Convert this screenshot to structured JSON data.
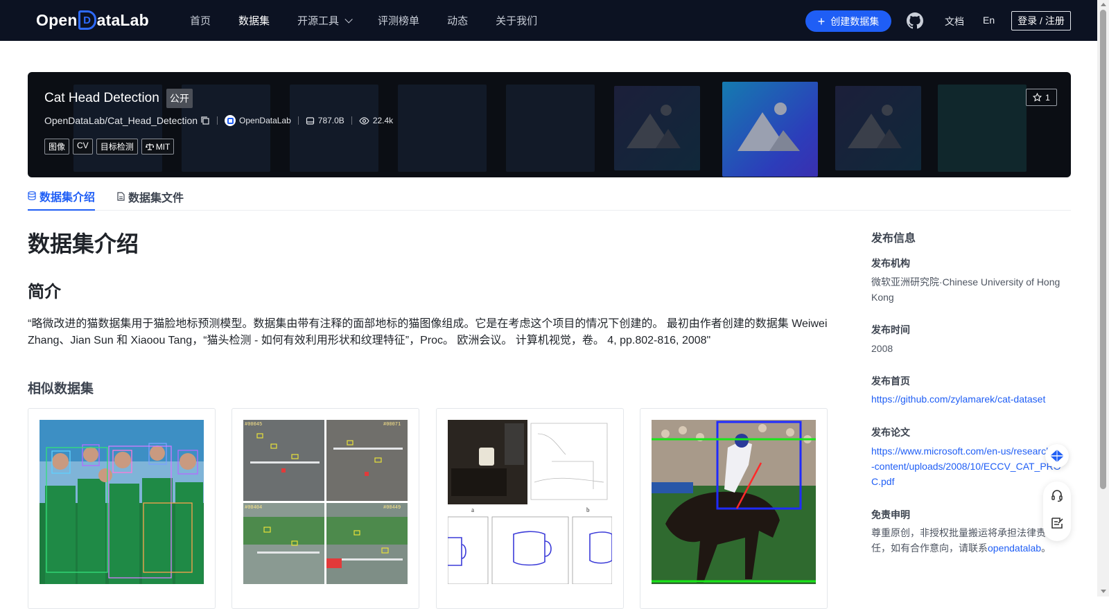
{
  "nav": {
    "logo": {
      "pre": "Open",
      "mark": "D",
      "post": "ataLab"
    },
    "items": [
      "首页",
      "数据集",
      "开源工具",
      "评测榜单",
      "动态",
      "关于我们"
    ],
    "active": "数据集",
    "create_label": "创建数据集",
    "docs_label": "文档",
    "lang_label": "En",
    "login_label": "登录 / 注册"
  },
  "dataset": {
    "title": "Cat Head Detection",
    "visibility": "公开",
    "path": "OpenDataLab/Cat_Head_Detection",
    "publisher": "OpenDataLab",
    "size": "787.0B",
    "views": "22.4k",
    "tags": [
      "图像",
      "CV",
      "目标检测"
    ],
    "license": "MIT",
    "stars": "1"
  },
  "tabs": [
    "数据集介绍",
    "数据集文件"
  ],
  "content": {
    "heading": "数据集介绍",
    "intro_heading": "简介",
    "description": "“略微改进的猫数据集用于猫脸地标预测模型。数据集由带有注释的面部地标的猫图像组成。它是在考虑这个项目的情况下创建的。 最初由作者创建的数据集 Weiwei Zhang、Jian Sun 和 Xiaoou Tang，“猫头检测 - 如何有效利用形状和纹理特征”，Proc。 欧洲会议。 计算机视觉，卷。 4, pp.802-816, 2008\"",
    "similar_heading": "相似数据集"
  },
  "sidebar": {
    "title": "发布信息",
    "org_label": "发布机构",
    "org_value": "微软亚洲研究院·Chinese University of Hong Kong",
    "time_label": "发布时间",
    "time_value": "2008",
    "home_label": "发布首页",
    "home_value": "https://github.com/zylamarek/cat-dataset",
    "paper_label": "发布论文",
    "paper_value": "https://www.microsoft.com/en-us/research/wp-content/uploads/2008/10/ECCV_CAT_PROC.pdf",
    "disclaimer_label": "免责申明",
    "disclaimer_value": "尊重原创，非授权批量搬运将承担法律责任，如有合作意向，请联系",
    "disclaimer_link": "opendatalab",
    "disclaimer_end": "。"
  },
  "similar_overlay_labels": [
    "#00045",
    "#00071",
    "#00404",
    "#00449"
  ],
  "figure_labels": [
    "a",
    "b"
  ],
  "colors": {
    "accent": "#1f5ef5",
    "nav_bg": "#0c1222",
    "banner_bg": "#0b0e14"
  },
  "icons": [
    "github-icon",
    "star-icon",
    "copy-icon",
    "hdd-icon",
    "eye-icon",
    "scale-icon",
    "database-icon",
    "file-icon",
    "headset-icon",
    "edit-icon",
    "ai-assistant-icon"
  ]
}
